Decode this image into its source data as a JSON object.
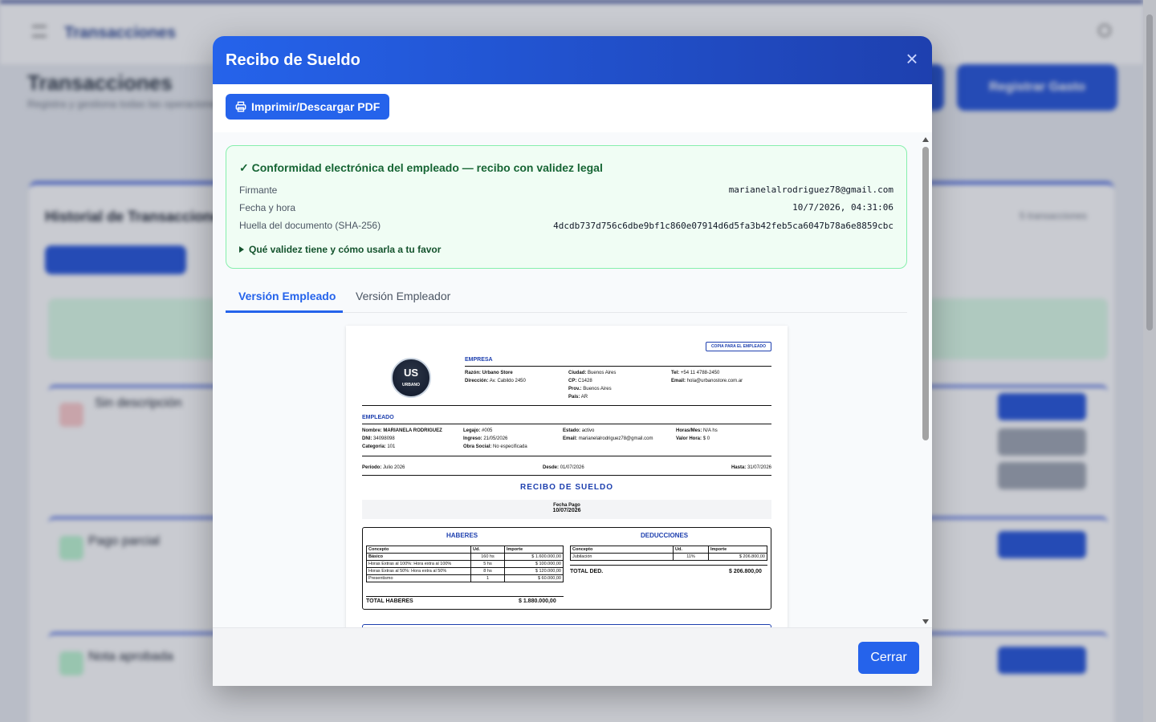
{
  "background": {
    "app_title": "Transacciones",
    "page_title": "Transacciones",
    "page_subtitle": "Registra y gestiona todas las operaciones financieras",
    "register_button": "Registrar Gasto",
    "history_title": "Historial de Transacciones",
    "history_count": "5 transacciones",
    "rows": [
      {
        "label": "Sin descripción"
      },
      {
        "label": "Pago parcial"
      },
      {
        "label": "Nota aprobada"
      }
    ]
  },
  "modal": {
    "title": "Recibo de Sueldo",
    "close_icon": "×",
    "print_label": "Imprimir/Descargar PDF",
    "validity": {
      "title": "✓ Conformidad electrónica del empleado — recibo con validez legal",
      "signer_label": "Firmante",
      "signer_value": "marianelalrodriguez78@gmail.com",
      "datetime_label": "Fecha y hora",
      "datetime_value": "10/7/2026, 04:31:06",
      "hash_label": "Huella del documento (SHA-256)",
      "hash_value": "4dcdb737d756c6dbe9bf1c860e07914d6d5fa3b42feb5ca6047b78a6e8859cbc",
      "toggle_label": "Qué validez tiene y cómo usarla a tu favor"
    },
    "tabs": [
      {
        "label": "Versión Empleado",
        "active": true
      },
      {
        "label": "Versión Empleador",
        "active": false
      }
    ],
    "close_button": "Cerrar"
  },
  "receipt": {
    "copy_badge": "COPIA PARA EL EMPLEADO",
    "logo_big": "US",
    "logo_small": "URBANO",
    "empresa_title": "EMPRESA",
    "empresa": {
      "razon_label": "Razón:",
      "razon": "Urbano Store",
      "direccion_label": "Dirección:",
      "direccion": "Av. Cabildo 2450",
      "ciudad_label": "Ciudad:",
      "ciudad": "Buenos Aires",
      "cp_label": "CP:",
      "cp": "C1428",
      "prov_label": "Prov.:",
      "prov": "Buenos Aires",
      "pais_label": "País:",
      "pais": "AR",
      "tel_label": "Tel:",
      "tel": "+54 11 4788-2450",
      "email_label": "Email:",
      "email": "hola@urbanostore.com.ar"
    },
    "empleado_title": "EMPLEADO",
    "empleado": {
      "nombre_label": "Nombre:",
      "nombre": "MARIANELA RODRIGUEZ",
      "dni_label": "DNI:",
      "dni": "34098098",
      "categoria_label": "Categoría:",
      "categoria": "101",
      "legajo_label": "Legajo:",
      "legajo": "#005",
      "ingreso_label": "Ingreso:",
      "ingreso": "21/05/2026",
      "obra_label": "Obra Social:",
      "obra": "No especificada",
      "estado_label": "Estado:",
      "estado": "activo",
      "email_label": "Email:",
      "email": "marianelalrodriguez78@gmail.com",
      "horas_label": "Horas/Mes:",
      "horas": "N/A hs",
      "valor_label": "Valor Hora:",
      "valor": "$ 0"
    },
    "periodo_label": "Período:",
    "periodo": "Julio 2026",
    "desde_label": "Desde:",
    "desde": "01/07/2026",
    "hasta_label": "Hasta:",
    "hasta": "31/07/2026",
    "main_title": "RECIBO DE SUELDO",
    "fecha_pago_label": "Fecha Pago",
    "fecha_pago": "10/07/2026",
    "haberes_title": "HABERES",
    "deducciones_title": "DEDUCCIONES",
    "col_concepto": "Concepto",
    "col_ud": "Ud.",
    "col_importe": "Importe",
    "haberes": [
      {
        "concepto": "Básico",
        "ud": "160 hs",
        "importe": "$ 1.600.000,00"
      },
      {
        "concepto": "Horas Extras al 100%: Hora extra al 100%",
        "ud": "5 hs",
        "importe": "$ 100.000,00"
      },
      {
        "concepto": "Horas Extras al 50%: Hora extra al 50%",
        "ud": "8 hs",
        "importe": "$ 120.000,00"
      },
      {
        "concepto": "Presentismo",
        "ud": "1",
        "importe": "$ 60.000,00"
      }
    ],
    "deducciones": [
      {
        "concepto": "Jubilación",
        "ud": "11%",
        "importe": "$ 206.800,00"
      }
    ],
    "total_haberes_label": "TOTAL HABERES",
    "total_haberes": "$ 1.880.000,00",
    "total_ded_label": "TOTAL DED.",
    "total_ded": "$ 206.800,00"
  }
}
